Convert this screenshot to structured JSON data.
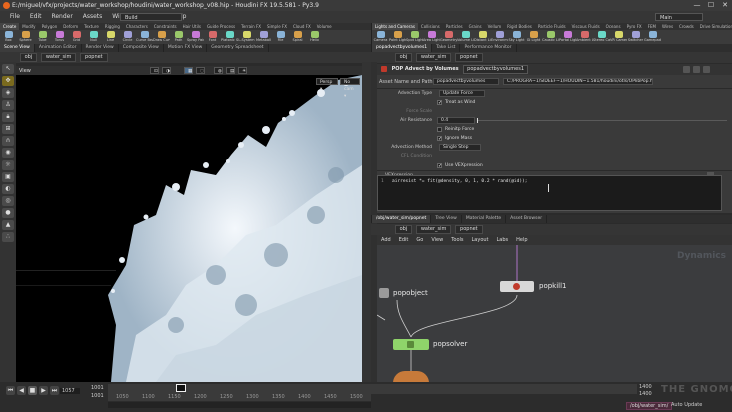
{
  "window": {
    "title": "E:/miguel/vfx/projects/water_workshop/houdini/water_workshop_v08.hip - Houdini FX 19.5.581 - Py3.9",
    "controls": [
      "—",
      "☐",
      "✕"
    ]
  },
  "menubar": {
    "items": [
      "File",
      "Edit",
      "Render",
      "Assets",
      "Windows",
      "Labs",
      "Help"
    ],
    "build_desktop": "Build",
    "main_desktop": "Main"
  },
  "left_shelf": {
    "tabs": [
      "Create",
      "Modify",
      "Polygon",
      "Deform",
      "Texture",
      "Rigging",
      "Characters",
      "Constraints",
      "Hair Utils",
      "Guide Process",
      "Terrain FX",
      "Simple FX",
      "Cloud FX",
      "Volume"
    ],
    "tools": [
      "Box",
      "Sphere",
      "Tube",
      "Torus",
      "Grid",
      "Null",
      "Line",
      "Circle",
      "Curve Bezier",
      "Draw Curve",
      "Path",
      "Spray Paint",
      "Font",
      "Platonic Solids",
      "L-System",
      "Metaball",
      "File",
      "Spiral",
      "Helix"
    ]
  },
  "right_shelf": {
    "tabs": [
      "Lights and Cameras",
      "Collisions",
      "Particles",
      "Grains",
      "Vellum",
      "Rigid Bodies",
      "Particle Fluids",
      "Viscous Fluids",
      "Oceans",
      "Pyro FX",
      "FEM",
      "Wires",
      "Crowds",
      "Drive Simulation"
    ],
    "tools": [
      "Camera",
      "Point Light",
      "Spot Light",
      "Area Light",
      "Geometry Light",
      "Volume Light",
      "Distant Light",
      "Environment Light",
      "Sky Light",
      "GI Light",
      "Caustic Light",
      "Portal Light",
      "Ambient Light",
      "Stereo Camera",
      "VR Camera",
      "Switcher",
      "Gamepad Camera"
    ]
  },
  "left_pane": {
    "tabs": [
      "Scene View",
      "Animation Editor",
      "Render View",
      "Composite View",
      "Motion FX View",
      "Geometry Spreadsheet"
    ],
    "path": [
      "obj",
      "water_sim",
      "popnet"
    ],
    "viewport_label": "View",
    "persp": "Persp ▾",
    "camera": "No cam ▾"
  },
  "params_pane": {
    "tabs": [
      "popadvectbyvolumes1",
      "Take List",
      "Performance Monitor"
    ],
    "path": [
      "obj",
      "water_sim",
      "popnet"
    ],
    "node_type": "POP Advect by Volumes",
    "node_name": "popadvectbyvolumes1",
    "asset_label": "Asset Name and Path",
    "asset_value": "popadvectbyvolumes",
    "asset_path": "C:/PROGRA~1/SIDEEF~1/HOUDIN~1.581/houdini/otls/OPlibPop.hda",
    "rows": [
      {
        "label": "Advection Type",
        "value": "Update Force"
      },
      {
        "check": "Treat as Wind"
      },
      {
        "label": "Force Scale",
        "dim": true
      },
      {
        "label": "Air Resistance",
        "value": "0.4"
      },
      {
        "check": "Reinitp Force"
      },
      {
        "check": "Ignore Mass"
      },
      {
        "label": "Advection Method",
        "value": "Single Step"
      },
      {
        "label": "CFL Condition",
        "dim": true
      },
      {
        "check": "Use VEXpression"
      }
    ],
    "vex_label": "VEXpression",
    "vex_line_no": "1",
    "vex_code": "airresist *= fit(@density, 0, 1, 0.2 * rand(@id));"
  },
  "network_pane": {
    "tabs": [
      "/obj/water_sim/popnet",
      "Tree View",
      "Material Palette",
      "Asset Browser"
    ],
    "path": [
      "obj",
      "water_sim",
      "popnet"
    ],
    "menu": [
      "Add",
      "Edit",
      "Go",
      "View",
      "Tools",
      "Layout",
      "Labs",
      "Help"
    ],
    "context_label": "Dynamics",
    "nodes": [
      {
        "name": "popobject",
        "color": "#9a9a9a"
      },
      {
        "name": "popkill1",
        "color": "#d8d8d8"
      },
      {
        "name": "popsolver",
        "color": "#8fd46a"
      }
    ]
  },
  "timeline": {
    "current_frame": "1057",
    "start": "1001",
    "start2": "1001",
    "ticks": [
      "1050",
      "1100",
      "1150",
      "1200",
      "1250",
      "1300",
      "1350",
      "1400",
      "1450",
      "1500"
    ],
    "end": "1400",
    "end2": "1400"
  },
  "statusbar": {
    "path": "/obj/water_sim/",
    "update": "Auto Update"
  },
  "watermark": "THE GNOMON WORKSHOP"
}
